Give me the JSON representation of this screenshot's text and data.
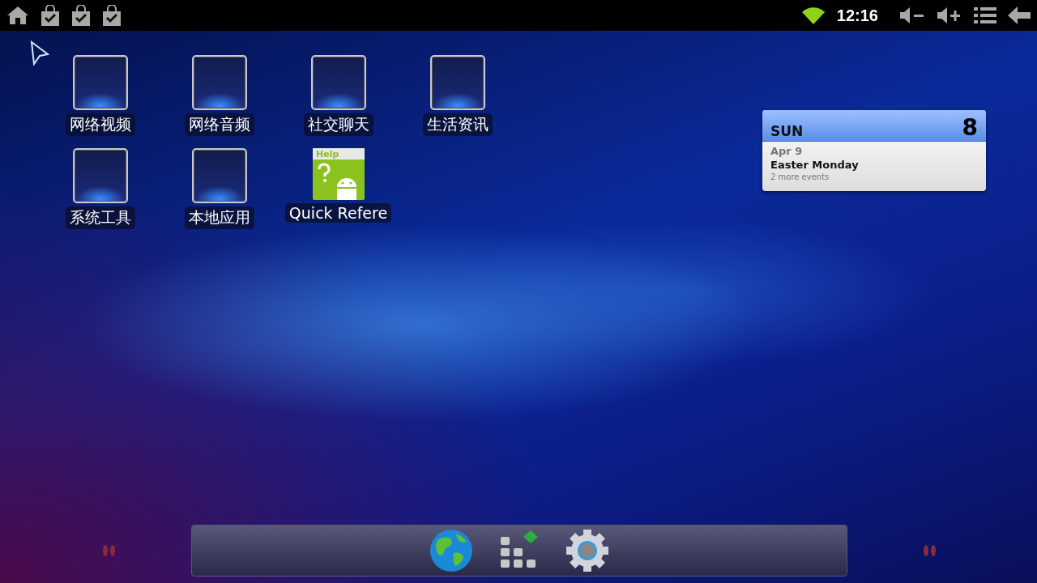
{
  "status_bar": {
    "time": "12:16"
  },
  "apps": [
    {
      "label": "网络视频",
      "kind": "folder"
    },
    {
      "label": "网络音频",
      "kind": "folder"
    },
    {
      "label": "社交聊天",
      "kind": "folder"
    },
    {
      "label": "生活资讯",
      "kind": "folder"
    },
    {
      "label": "系统工具",
      "kind": "folder"
    },
    {
      "label": "本地应用",
      "kind": "folder"
    },
    {
      "label": "Quick Refere",
      "kind": "help",
      "icon_text": "Help"
    }
  ],
  "calendar_widget": {
    "weekday": "SUN",
    "day": "8",
    "date": "Apr 9",
    "event": "Easter Monday",
    "more": "2 more events"
  }
}
